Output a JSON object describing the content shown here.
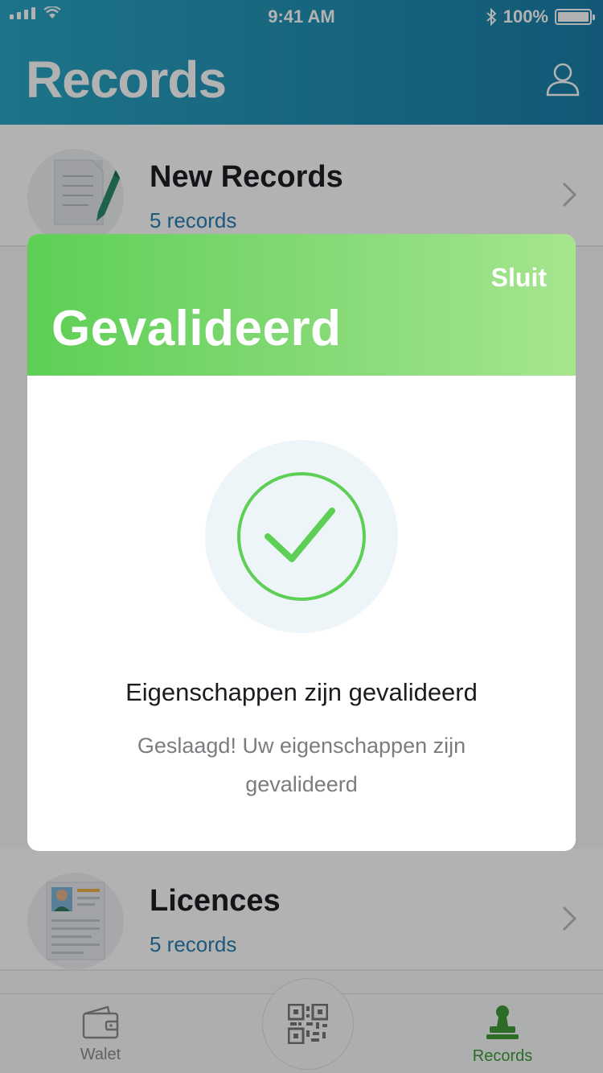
{
  "status_bar": {
    "time": "9:41 AM",
    "battery": "100%"
  },
  "header": {
    "title": "Records"
  },
  "list": {
    "items": [
      {
        "title": "New Records",
        "subtitle": "5 records"
      },
      {
        "title": "Licences",
        "subtitle": "5 records"
      }
    ]
  },
  "tabbar": {
    "tabs": [
      {
        "label": "Walet",
        "active": false
      },
      {
        "label": "Records",
        "active": true
      }
    ],
    "colors": {
      "active": "#3f9b38",
      "inactive": "#8a8d91"
    }
  },
  "modal": {
    "close_label": "Sluit",
    "title": "Gevalideerd",
    "heading": "Eigenschappen zijn gevalideerd",
    "message": "Geslaagd! Uw eigenschappen zijn gevalideerd",
    "accent_color": "#5dcf55"
  }
}
